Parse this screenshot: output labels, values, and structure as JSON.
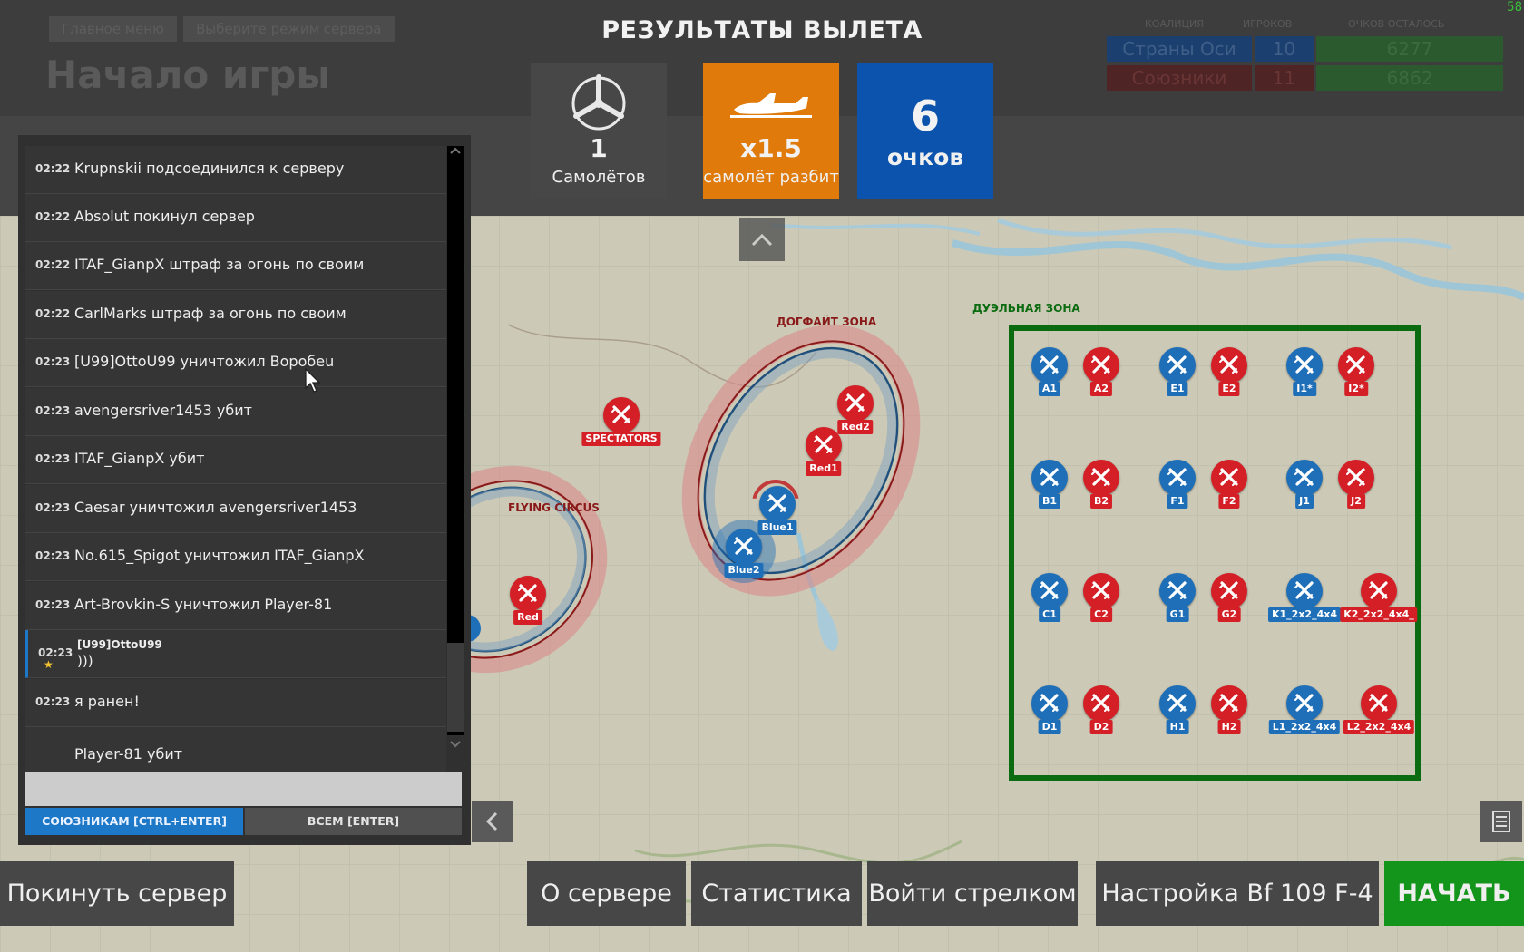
{
  "fps": "58",
  "breadcrumbs": [
    "Главное меню",
    "Выберите режим сервера"
  ],
  "page_title": "Начало игры",
  "scoreboard": {
    "headers": [
      "КОАЛИЦИЯ",
      "ИГРОКОВ",
      "ОЧКОВ ОСТАЛОСЬ"
    ],
    "rows": [
      {
        "coalition": "Страны Оси",
        "players": "10",
        "points": "6277",
        "color": "#1b4a8a"
      },
      {
        "coalition": "Союзники",
        "players": "11",
        "points": "6862",
        "color": "#7a2020"
      }
    ]
  },
  "results": {
    "title": "РЕЗУЛЬТАТЫ ВЫЛЕТА",
    "planes_value": "1",
    "planes_label": "Самолётов",
    "multiplier_value": "x1.5",
    "multiplier_label": "самолёт разбит",
    "points_value": "6",
    "points_label": "очков"
  },
  "chat": {
    "messages": [
      {
        "time": "02:22",
        "text": "Krupnskii подсоединился к серверу"
      },
      {
        "time": "02:22",
        "text": "Absolut покинул сервер"
      },
      {
        "time": "02:22",
        "text": "ITAF_GianpX штраф за огонь по своим"
      },
      {
        "time": "02:22",
        "text": "CarlMarks штраф за огонь по своим"
      },
      {
        "time": "02:23",
        "text": "[U99]OttoU99 уничтожил Воробеu"
      },
      {
        "time": "02:23",
        "text": "avengersriver1453 убит"
      },
      {
        "time": "02:23",
        "text": "ITAF_GianpX убит"
      },
      {
        "time": "02:23",
        "text": "Caesar уничтожил avengersriver1453"
      },
      {
        "time": "02:23",
        "text": "No.615_Spigot уничтожил ITAF_GianpX"
      },
      {
        "time": "02:23",
        "text": "Art-Brovkin-S уничтожил Player-81"
      }
    ],
    "player_message": {
      "time": "02:23",
      "author": "[U99]OttoU99",
      "text": ")))"
    },
    "last_message": {
      "time": "02:23",
      "text": "я ранен!"
    },
    "cut_message": "Player-81 убит",
    "input_value": "",
    "send_allies_label": "СОЮЗНИКАМ [CTRL+ENTER]",
    "send_all_label": "ВСЕМ [ENTER]"
  },
  "map": {
    "zones": {
      "dogfight": "ДОГФАЙТ ЗОНА",
      "duel": "ДУЭЛЬНАЯ ЗОНА",
      "circus": "FLYING CIRCUS"
    },
    "spawns": {
      "spectators": "SPECTATORS",
      "red_circus": "Red",
      "red1": "Red1",
      "red2": "Red2",
      "blue1": "Blue1",
      "blue2": "Blue2",
      "duel_grid": [
        [
          "A1",
          "A2",
          "E1",
          "E2",
          "I1*",
          "I2*"
        ],
        [
          "B1",
          "B2",
          "F1",
          "F2",
          "J1",
          "J2"
        ],
        [
          "C1",
          "C2",
          "G1",
          "G2",
          "K1_2x2_4x4",
          "K2_2x2_4x4_"
        ],
        [
          "D1",
          "D2",
          "H1",
          "H2",
          "L1_2x2_4x4",
          "L2_2x2_4x4"
        ]
      ]
    },
    "colors": {
      "blue": "#1f6fb8",
      "red": "#d41f26",
      "duel_border": "#0b6b10"
    }
  },
  "bottom_bar": {
    "leave": "Покинуть сервер",
    "about": "О сервере",
    "stats": "Статистика",
    "gunner": "Войти стрелком",
    "setup": "Настройка Bf 109 F-4",
    "start": "НАЧАТЬ"
  }
}
